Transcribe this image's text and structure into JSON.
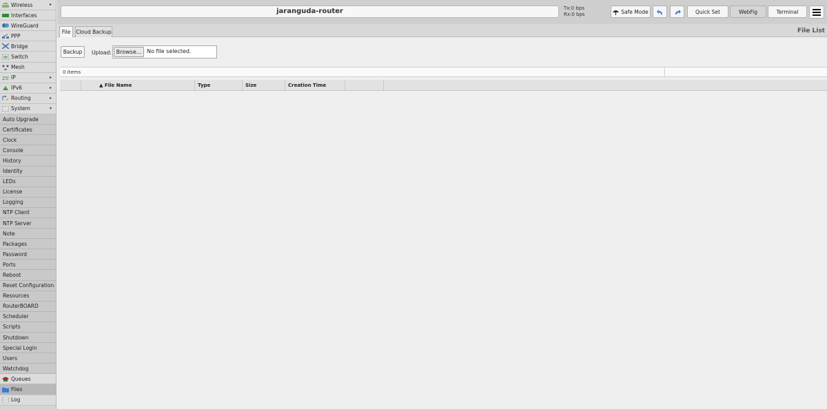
{
  "sidebar": {
    "items_top": [
      {
        "label": "Wireless",
        "icon": "wireless-icon",
        "arrow": "▸"
      },
      {
        "label": "Interfaces",
        "icon": "interfaces-icon",
        "arrow": ""
      },
      {
        "label": "WireGuard",
        "icon": "wireguard-icon",
        "arrow": ""
      },
      {
        "label": "PPP",
        "icon": "ppp-icon",
        "arrow": ""
      },
      {
        "label": "Bridge",
        "icon": "bridge-icon",
        "arrow": ""
      },
      {
        "label": "Switch",
        "icon": "switch-icon",
        "arrow": ""
      },
      {
        "label": "Mesh",
        "icon": "mesh-icon",
        "arrow": ""
      },
      {
        "label": "IP",
        "icon": "ip-icon",
        "arrow": "▸"
      },
      {
        "label": "IPv6",
        "icon": "ipv6-icon",
        "arrow": "▸"
      },
      {
        "label": "Routing",
        "icon": "routing-icon",
        "arrow": "▸"
      },
      {
        "label": "System",
        "icon": "system-icon",
        "arrow": "▾"
      }
    ],
    "system_submenu": [
      "Auto Upgrade",
      "Certificates",
      "Clock",
      "Console",
      "History",
      "Identity",
      "LEDs",
      "License",
      "Logging",
      "NTP Client",
      "NTP Server",
      "Note",
      "Packages",
      "Password",
      "Ports",
      "Reboot",
      "Reset Configuration",
      "Resources",
      "RouterBOARD",
      "Scheduler",
      "Scripts",
      "Shutdown",
      "Special Login",
      "Users",
      "Watchdog"
    ],
    "items_bottom": [
      {
        "label": "Queues",
        "icon": "queues-icon"
      },
      {
        "label": "Files",
        "icon": "files-icon"
      },
      {
        "label": "Log",
        "icon": "log-icon"
      }
    ]
  },
  "topbar": {
    "hostname": "jaranguda-router",
    "tx": "Tx:0 bps",
    "rx": "Rx:0 bps",
    "safe_mode": "Safe Mode",
    "quick_set": "Quick Set",
    "webfig": "WebFig",
    "terminal": "Terminal"
  },
  "tabs": {
    "file": "File",
    "cloud_backup": "Cloud Backup",
    "window_title": "File List"
  },
  "content": {
    "backup_label": "Backup",
    "upload_label": "Upload:",
    "browse_label": "Browse...",
    "file_status": "No file selected.",
    "items_count": "0 items",
    "columns": [
      "▲ File Name",
      "Type",
      "Size",
      "Creation Time"
    ]
  },
  "colors": {
    "sidebar_bg": "#dcdcdc",
    "submenu_bg": "#c9c9c9",
    "content_bg": "#efefef",
    "undo_blue": "#3a7bd5"
  }
}
